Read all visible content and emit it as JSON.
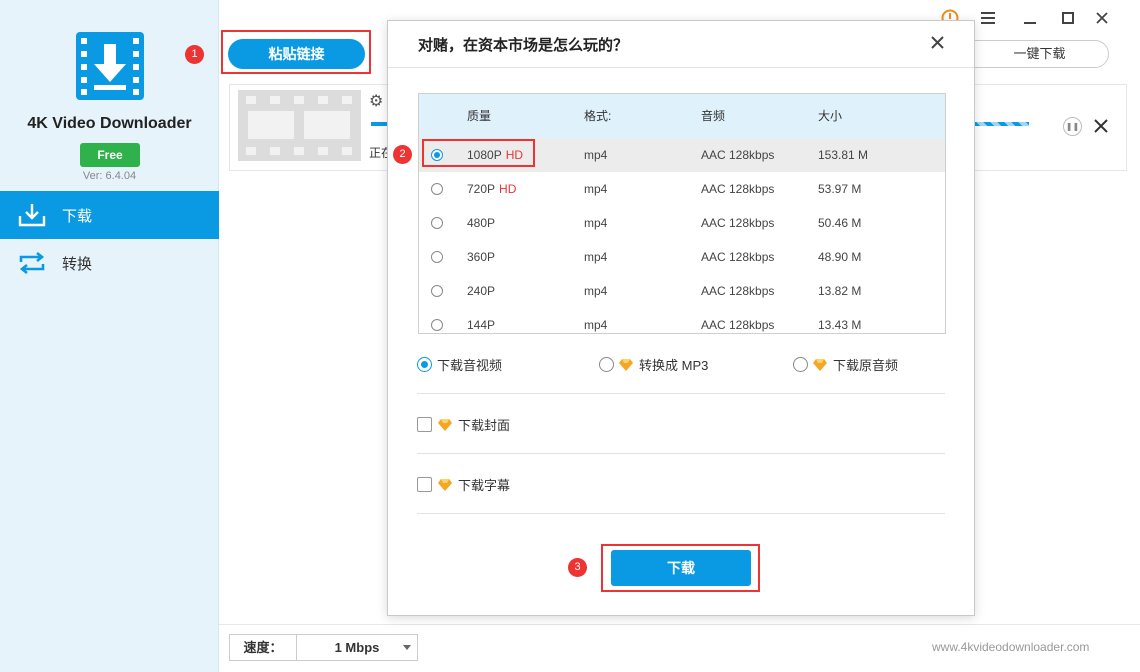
{
  "app": {
    "name": "4K Video Downloader",
    "badge": "Free",
    "version": "Ver: 6.4.04"
  },
  "sidebar": {
    "items": [
      {
        "label": "下载",
        "icon": "download-tray-icon",
        "active": true
      },
      {
        "label": "转换",
        "icon": "convert-arrows-icon",
        "active": false
      }
    ]
  },
  "toolbar": {
    "paste_label": "粘贴链接",
    "onekey_label": "一键下载"
  },
  "download_row": {
    "status": "正在"
  },
  "steps": {
    "one": "1",
    "two": "2",
    "three": "3"
  },
  "dialog": {
    "title": "对赌，在资本市场是怎么玩的？",
    "columns": {
      "quality": "质量",
      "format": "格式:",
      "audio": "音频",
      "size": "大小"
    },
    "rows": [
      {
        "quality": "1080P",
        "hd": "HD",
        "format": "mp4",
        "audio": "AAC 128kbps",
        "size": "153.81 M",
        "selected": true
      },
      {
        "quality": "720P",
        "hd": "HD",
        "format": "mp4",
        "audio": "AAC 128kbps",
        "size": "53.97 M",
        "selected": false
      },
      {
        "quality": "480P",
        "hd": "",
        "format": "mp4",
        "audio": "AAC 128kbps",
        "size": "50.46 M",
        "selected": false
      },
      {
        "quality": "360P",
        "hd": "",
        "format": "mp4",
        "audio": "AAC 128kbps",
        "size": "48.90 M",
        "selected": false
      },
      {
        "quality": "240P",
        "hd": "",
        "format": "mp4",
        "audio": "AAC 128kbps",
        "size": "13.82 M",
        "selected": false
      },
      {
        "quality": "144P",
        "hd": "",
        "format": "mp4",
        "audio": "AAC 128kbps",
        "size": "13.43 M",
        "selected": false
      }
    ],
    "mode_options": [
      {
        "label": "下载音视频",
        "selected": true,
        "premium": false
      },
      {
        "label": "转换成 MP3",
        "selected": false,
        "premium": true
      },
      {
        "label": "下载原音频",
        "selected": false,
        "premium": true
      }
    ],
    "cover_label": "下载封面",
    "subtitle_label": "下载字幕",
    "download_label": "下载"
  },
  "footer": {
    "speed_label": "速度：",
    "speed_value": "1 Mbps",
    "website": "www.4kvideodownloader.com"
  },
  "colors": {
    "accent": "#0a9ae3",
    "sidebar_bg": "#e6f3fb",
    "free_badge": "#2fb24c",
    "highlight": "#ee3333",
    "premium_gem": "#f5a623"
  }
}
